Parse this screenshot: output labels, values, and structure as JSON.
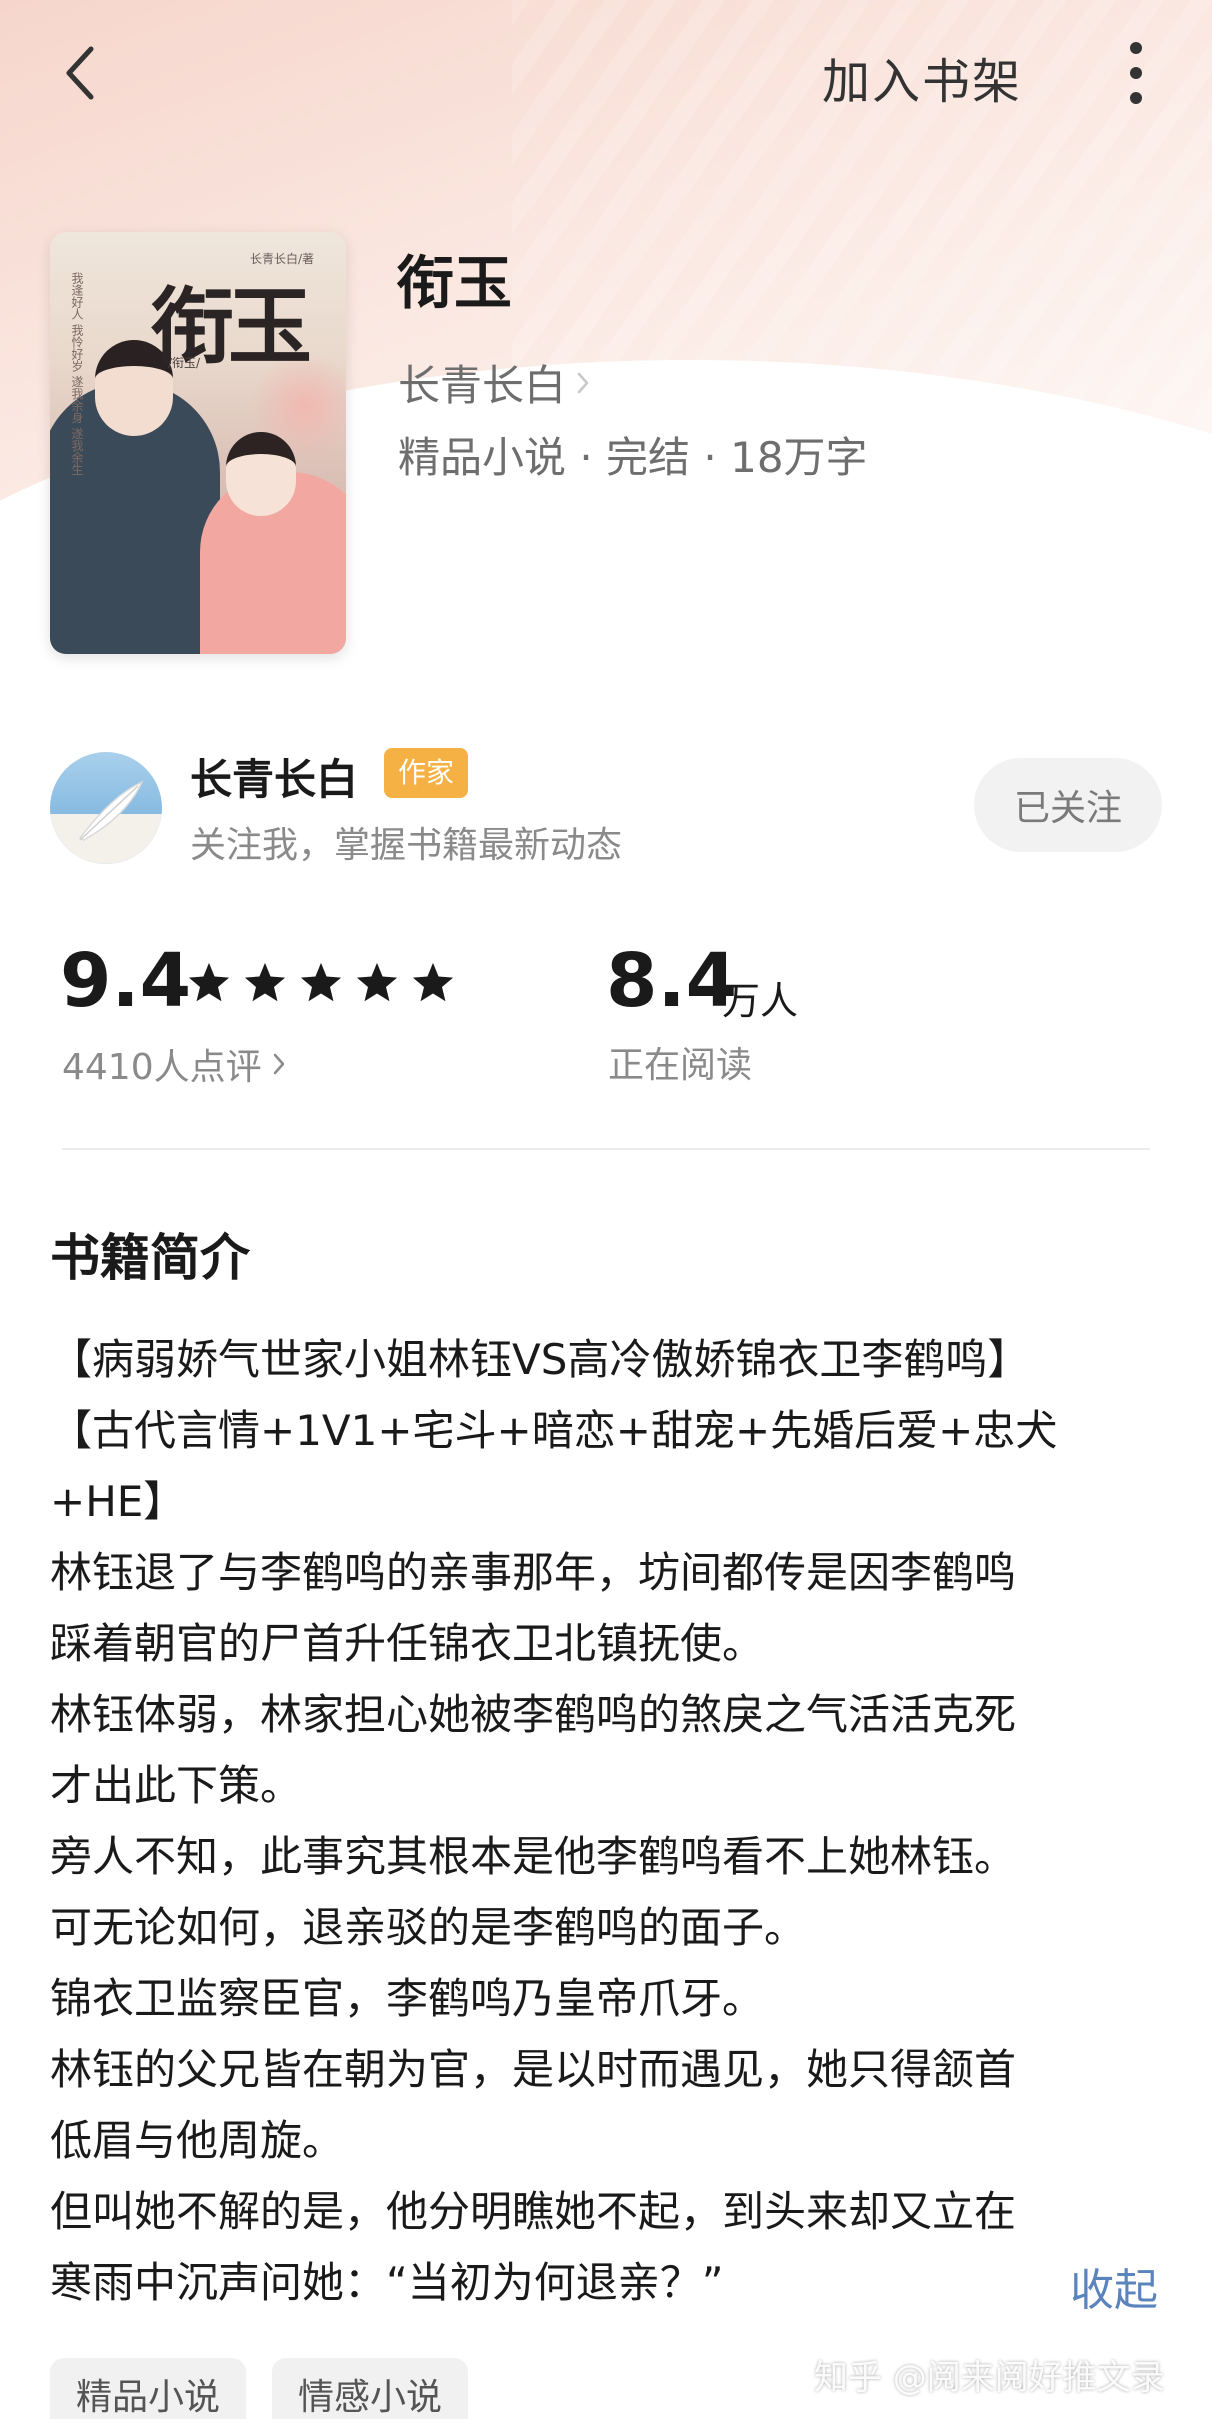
{
  "header": {
    "add_to_shelf": "加入书架"
  },
  "book": {
    "title": "衔玉",
    "author": "长青长白",
    "meta": "精品小说 · 完结 · 18万字",
    "cover": {
      "title": "衔玉",
      "author_small": "长青长白/著",
      "sub": "/衔玉/",
      "poem": "我逢好人 我怜好岁 遂我余身 遂我余生"
    }
  },
  "author_card": {
    "name": "长青长白",
    "badge": "作家",
    "desc": "关注我，掌握书籍最新动态",
    "follow_label": "已关注"
  },
  "stats": {
    "score": "9.4",
    "star_count": 5,
    "reviews": "4410人点评",
    "reading_value": "8.4",
    "reading_unit": "万人",
    "reading_label": "正在阅读"
  },
  "intro": {
    "heading": "书籍简介",
    "lines": [
      "【病弱娇气世家小姐林钰VS高冷傲娇锦衣卫李鹤鸣】",
      "【古代言情+1V1+宅斗+暗恋+甜宠+先婚后爱+忠犬",
      "+HE】",
      "林钰退了与李鹤鸣的亲事那年，坊间都传是因李鹤鸣",
      "踩着朝官的尸首升任锦衣卫北镇抚使。",
      "林钰体弱，林家担心她被李鹤鸣的煞戾之气活活克死",
      "才出此下策。",
      "旁人不知，此事究其根本是他李鹤鸣看不上她林钰。",
      "可无论如何，退亲驳的是李鹤鸣的面子。",
      "锦衣卫监察臣官，李鹤鸣乃皇帝爪牙。",
      "林钰的父兄皆在朝为官，是以时而遇见，她只得颔首",
      "低眉与他周旋。",
      "但叫她不解的是，他分明瞧她不起，到头来却又立在",
      "寒雨中沉声问她：“当初为何退亲？”"
    ],
    "collapse_label": "收起"
  },
  "tags": [
    "精品小说",
    "情感小说"
  ],
  "watermark": "知乎 @阅来阅好推文录",
  "colors": {
    "accent_link": "#5b84bd",
    "badge": "#f6b144"
  }
}
